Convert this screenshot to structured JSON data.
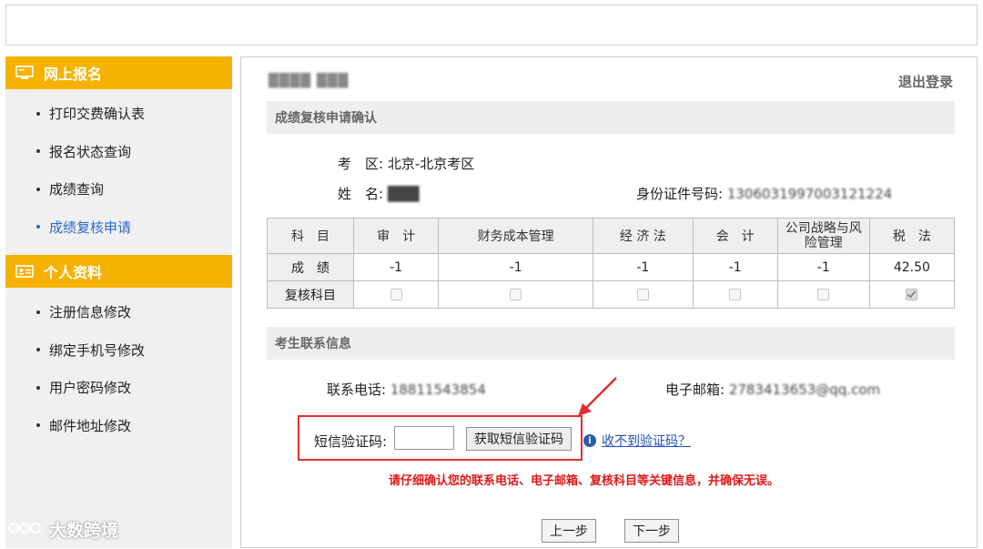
{
  "sidebar": {
    "sections": [
      {
        "title": "网上报名",
        "icon": "monitor-icon",
        "items": [
          "打印交费确认表",
          "报名状态查询",
          "成绩查询",
          "成绩复核申请"
        ],
        "active_index": 3
      },
      {
        "title": "个人资料",
        "icon": "id-card-icon",
        "items": [
          "注册信息修改",
          "绑定手机号修改",
          "用户密码修改",
          "邮件地址修改"
        ]
      }
    ],
    "brand": "大数跨境"
  },
  "header": {
    "user_blurred": "████ ███",
    "logout": "退出登录"
  },
  "confirm": {
    "title": "成绩复核申请确认",
    "exam_area_label": "考　区:",
    "exam_area_value": "北京-北京考区",
    "name_label": "姓　名:",
    "name_value": "███",
    "id_label": "身份证件号码:",
    "id_value": "1306031997003121224"
  },
  "scores": {
    "header": [
      "科　目",
      "审　计",
      "财务成本管理",
      "经 济 法",
      "会　计",
      "公司战略与风险管理",
      "税　法"
    ],
    "score_label": "成　绩",
    "values": [
      "-1",
      "-1",
      "-1",
      "-1",
      "-1",
      "42.50"
    ],
    "review_label": "复核科目",
    "review_checked": [
      false,
      false,
      false,
      false,
      false,
      true
    ]
  },
  "contact": {
    "title": "考生联系信息",
    "phone_label": "联系电话:",
    "phone_value": "18811543854",
    "email_label": "电子邮箱:",
    "email_value": "2783413653@qq.com",
    "sms_label": "短信验证码:",
    "sms_value": "",
    "sms_button": "获取短信验证码",
    "help_link": "收不到验证码？",
    "warning": "请仔细确认您的联系电话、电子邮箱、复核科目等关键信息，并确保无误。"
  },
  "nav": {
    "prev": "上一步",
    "next": "下一步"
  },
  "colors": {
    "sidebar_header": "#f6b200",
    "highlight_border": "#e0312d",
    "warning_text": "#e01818",
    "active_link": "#2a6ad0"
  }
}
